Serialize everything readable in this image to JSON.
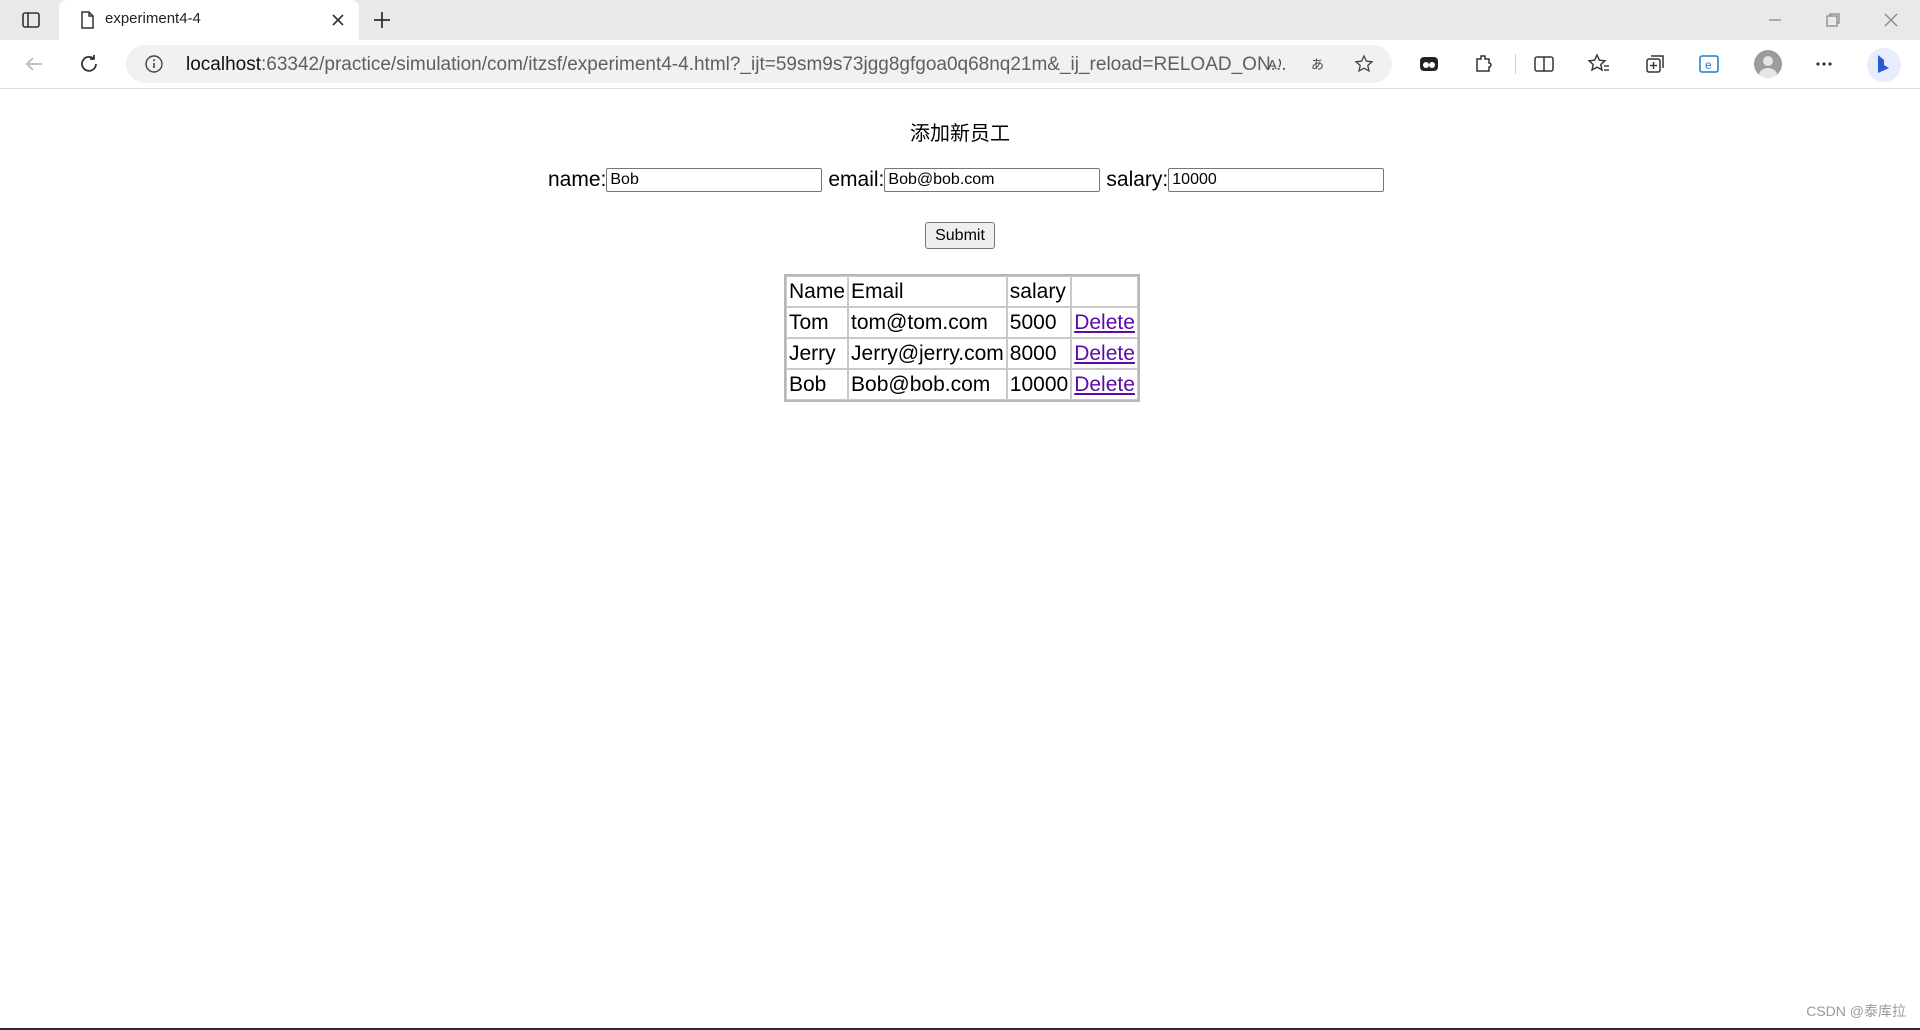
{
  "browser": {
    "tab_title": "experiment4-4",
    "url_host": "localhost",
    "url_rest": ":63342/practice/simulation/com/itzsf/experiment4-4.html?_ijt=59sm9s73jgg8gfgoa0q68nq21m&_ij_reload=RELOAD_ON..."
  },
  "page": {
    "heading": "添加新员工",
    "form": {
      "name_label": "name:",
      "name_value": "Bob",
      "email_label": "email:",
      "email_value": "Bob@bob.com",
      "salary_label": "salary:",
      "salary_value": "10000",
      "submit_label": "Submit"
    },
    "table": {
      "headers": [
        "Name",
        "Email",
        "salary",
        ""
      ],
      "rows": [
        {
          "name": "Tom",
          "email": "tom@tom.com",
          "salary": "5000",
          "action": "Delete"
        },
        {
          "name": "Jerry",
          "email": "Jerry@jerry.com",
          "salary": "8000",
          "action": "Delete"
        },
        {
          "name": "Bob",
          "email": "Bob@bob.com",
          "salary": "10000",
          "action": "Delete"
        }
      ]
    }
  },
  "watermark": "CSDN @泰库拉"
}
